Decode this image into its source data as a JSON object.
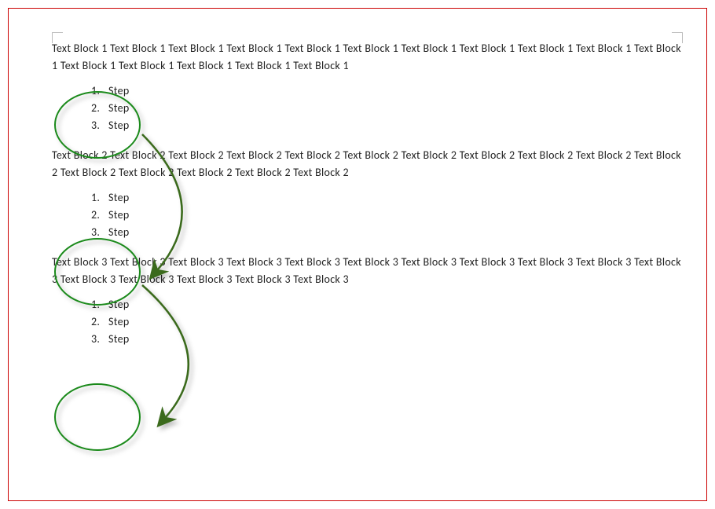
{
  "blocks": [
    {
      "para": "Text Block 1 Text Block 1 Text Block 1 Text Block 1 Text Block 1 Text Block 1 Text Block 1 Text Block 1 Text Block 1 Text Block 1 Text Block 1 Text Block 1 Text Block 1 Text Block 1 Text Block 1 Text Block 1",
      "steps": [
        {
          "num": "1.",
          "label": "Step"
        },
        {
          "num": "2.",
          "label": "Step"
        },
        {
          "num": "3.",
          "label": "Step"
        }
      ]
    },
    {
      "para": "Text Block 2 Text Block 2 Text Block 2 Text Block 2 Text Block 2 Text Block 2 Text Block 2 Text Block 2 Text Block 2 Text Block 2 Text Block 2 Text Block 2 Text Block 2 Text Block 2 Text Block 2 Text Block 2",
      "steps": [
        {
          "num": "1.",
          "label": "Step"
        },
        {
          "num": "2.",
          "label": "Step"
        },
        {
          "num": "3.",
          "label": "Step"
        }
      ]
    },
    {
      "para": "Text Block 3 Text Block 3 Text Block 3 Text Block 3 Text Block 3 Text Block 3 Text Block 3 Text Block 3 Text Block 3 Text Block 3 Text Block 3 Text Block 3 Text Block 3 Text Block 3 Text Block 3 Text Block 3",
      "steps": [
        {
          "num": "1.",
          "label": "Step"
        },
        {
          "num": "2.",
          "label": "Step"
        },
        {
          "num": "3.",
          "label": "Step"
        }
      ]
    }
  ],
  "annotations": {
    "circle_color": "#1a8a1a",
    "arrow_color": "#3a6b1f"
  }
}
